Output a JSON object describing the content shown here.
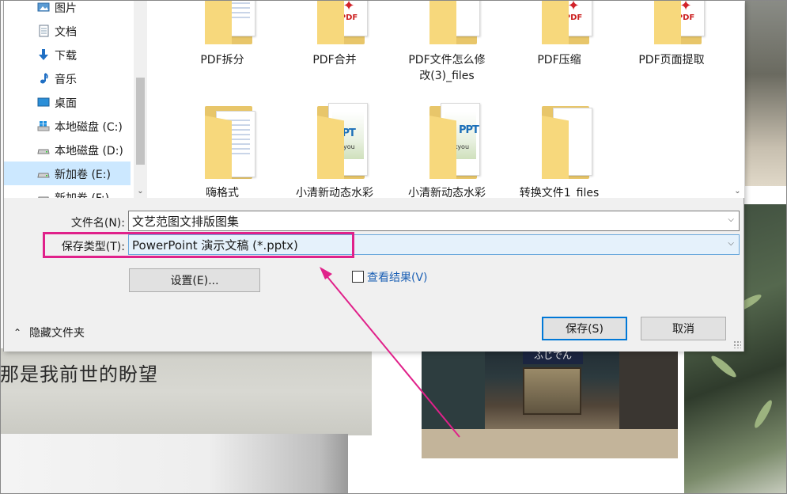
{
  "background": {
    "poem_text": "那是我前世的盼望",
    "shop_sign": "ふじでん"
  },
  "nav": {
    "items": [
      {
        "label": "图片",
        "icon": "pictures-icon"
      },
      {
        "label": "文档",
        "icon": "documents-icon"
      },
      {
        "label": "下载",
        "icon": "download-icon"
      },
      {
        "label": "音乐",
        "icon": "music-icon"
      },
      {
        "label": "桌面",
        "icon": "desktop-icon"
      },
      {
        "label": "本地磁盘 (C:)",
        "icon": "windows-drive-icon"
      },
      {
        "label": "本地磁盘 (D:)",
        "icon": "drive-icon"
      },
      {
        "label": "新加卷 (E:)",
        "icon": "drive-icon"
      },
      {
        "label": "新加卷 (F:)",
        "icon": "drive-icon"
      }
    ]
  },
  "files": {
    "row1": [
      {
        "name": "PDF拆分",
        "type": "docs"
      },
      {
        "name": "PDF合并",
        "type": "pdf"
      },
      {
        "name": "PDF文件怎么修改(3)_files",
        "name_line1": "PDF文件怎么修",
        "name_line2": "改(3)_files",
        "type": "blank"
      },
      {
        "name": "PDF压缩",
        "type": "pdf"
      },
      {
        "name": "PDF页面提取",
        "type": "pdf"
      }
    ],
    "row2": [
      {
        "name": "嗨格式",
        "type": "docs"
      },
      {
        "name": "小清新动态水彩",
        "type": "ppt",
        "thumb_text": "PPT",
        "thumb_sub": "you"
      },
      {
        "name": "小清新动态水彩",
        "type": "ppt",
        "thumb_text": "PPT",
        "thumb_sub": "ankyou"
      },
      {
        "name": "转换文件1_files",
        "type": "blank"
      }
    ],
    "pdf_label": "PDF"
  },
  "form": {
    "filename_label": "文件名(N):",
    "filename_value": "文艺范图文排版图集",
    "savetype_label": "保存类型(T):",
    "savetype_value": "PowerPoint 演示文稿 (*.pptx)",
    "settings_button": "设置(E)...",
    "view_result_label": "查看结果(V)",
    "view_result_checked": false,
    "hide_folders": "隐藏文件夹",
    "save_button": "保存(S)",
    "cancel_button": "取消"
  },
  "annotation": {
    "color": "#e0218a"
  }
}
